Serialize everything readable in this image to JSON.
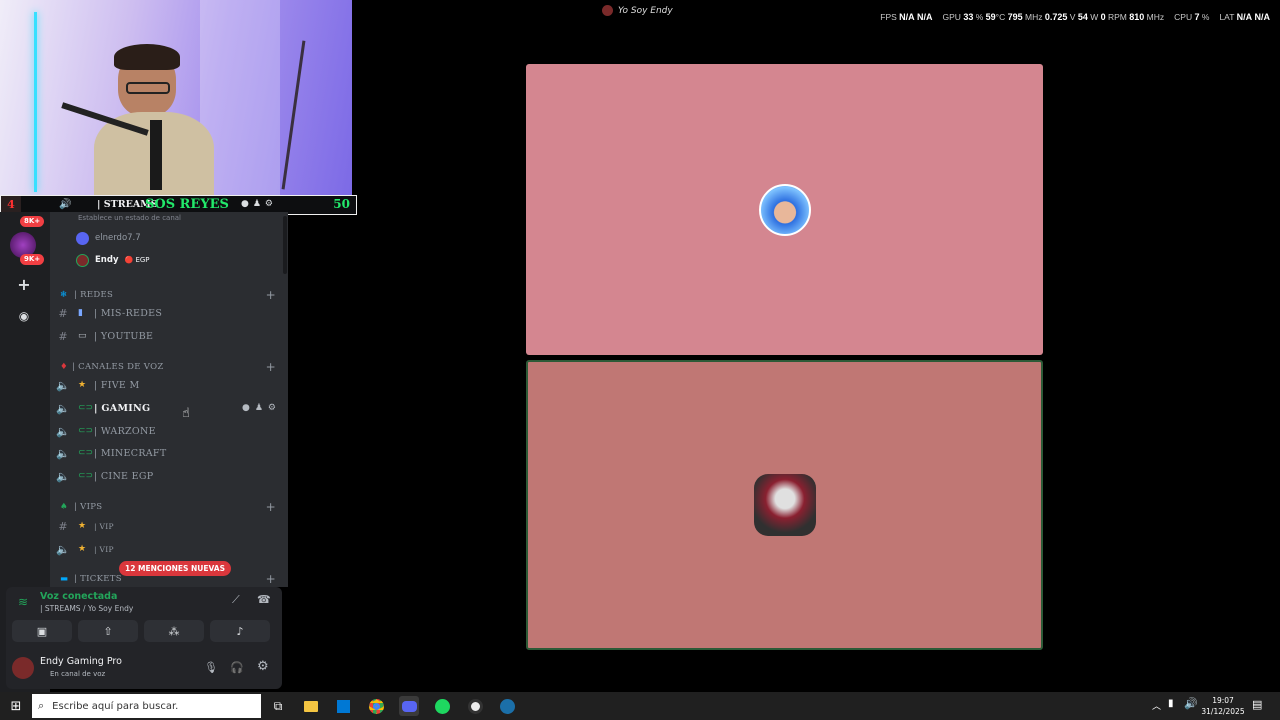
{
  "top_overlay": {
    "window_title": "Yo Soy Endy",
    "osd": {
      "fps_label": "FPS",
      "fps_value1": "N/A",
      "fps_value2": "N/A",
      "gpu_label": "GPU",
      "gpu_load": "33",
      "gpu_load_unit": "%",
      "gpu_temp": "59",
      "gpu_temp_unit": "°C",
      "gpu_clock": "795",
      "gpu_clock_unit": "MHz",
      "gpu_voltage": "0.725",
      "gpu_voltage_unit": "V",
      "gpu_power": "54",
      "gpu_power_unit": "W",
      "fan": "0",
      "fan_unit": "RPM",
      "mem_clock": "810",
      "mem_clock_unit": "MHz",
      "cpu_label": "CPU",
      "cpu_load": "7",
      "cpu_load_unit": "%",
      "lat_label": "LAT",
      "lat_value1": "N/A",
      "lat_value2": "N/A"
    }
  },
  "stream_bar": {
    "left_count": "4",
    "channel_label": "| STREAMS",
    "title": "SOS REYES",
    "right_count": "50"
  },
  "server_rail": {
    "badge1": "8K+",
    "badge2": "9K+"
  },
  "channel_list": {
    "status_hint": "Establece un estado de canal",
    "voice_users": [
      {
        "name": "elnerdo7.7"
      },
      {
        "name": "Endy",
        "tag": "EGP"
      }
    ],
    "categories": {
      "redes": "| REDES",
      "canales_de_voz": "| CANALES DE VOZ",
      "vips": "| VIPS",
      "tickets": "| TICKETS"
    },
    "channels": {
      "mis_redes": "| MIS-REDES",
      "youtube": "| YOUTUBE",
      "five_m": "| FIVE M",
      "gaming": "| GAMING",
      "warzone": "| WARZONE",
      "minecraft": "| MINECRAFT",
      "cine_egp": "| CINE EGP",
      "vip1": "| VIP",
      "vip2": "| VIP"
    },
    "mentions_pill": "12 MENCIONES NUEVAS"
  },
  "voice_panel": {
    "status": "Voz conectada",
    "channel": "| STREAMS / Yo Soy Endy"
  },
  "user_panel": {
    "name": "Endy Gaming Pro",
    "status": "En canal de voz"
  },
  "taskbar": {
    "search_placeholder": "Escribe aquí para buscar.",
    "time": "19:07",
    "date": "31/12/2025"
  },
  "colors": {
    "tile_top": "#d48690",
    "tile_bottom": "#c07774",
    "voice_green": "#23a55a",
    "mention_red": "#da373c"
  }
}
